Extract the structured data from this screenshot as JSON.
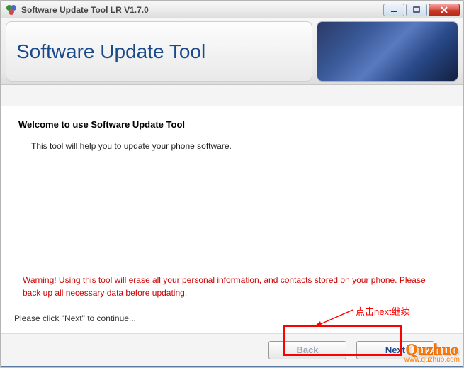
{
  "titlebar": {
    "title": "Software Update Tool LR V1.7.0"
  },
  "header": {
    "title": "Software Update Tool"
  },
  "content": {
    "heading": "Welcome to use Software Update Tool",
    "description": "This tool will help you to update your phone software.",
    "warning": "Warning! Using this tool will erase all your personal information, and contacts stored on your phone. Please back up all necessary data before updating.",
    "instruction": "Please click \"Next\" to continue..."
  },
  "footer": {
    "back_label": "Back",
    "next_label": "Next"
  },
  "annotation": {
    "text": "点击next继续"
  },
  "watermark": {
    "logo": "Quzhuo",
    "url": "www.quzhuo.com"
  }
}
